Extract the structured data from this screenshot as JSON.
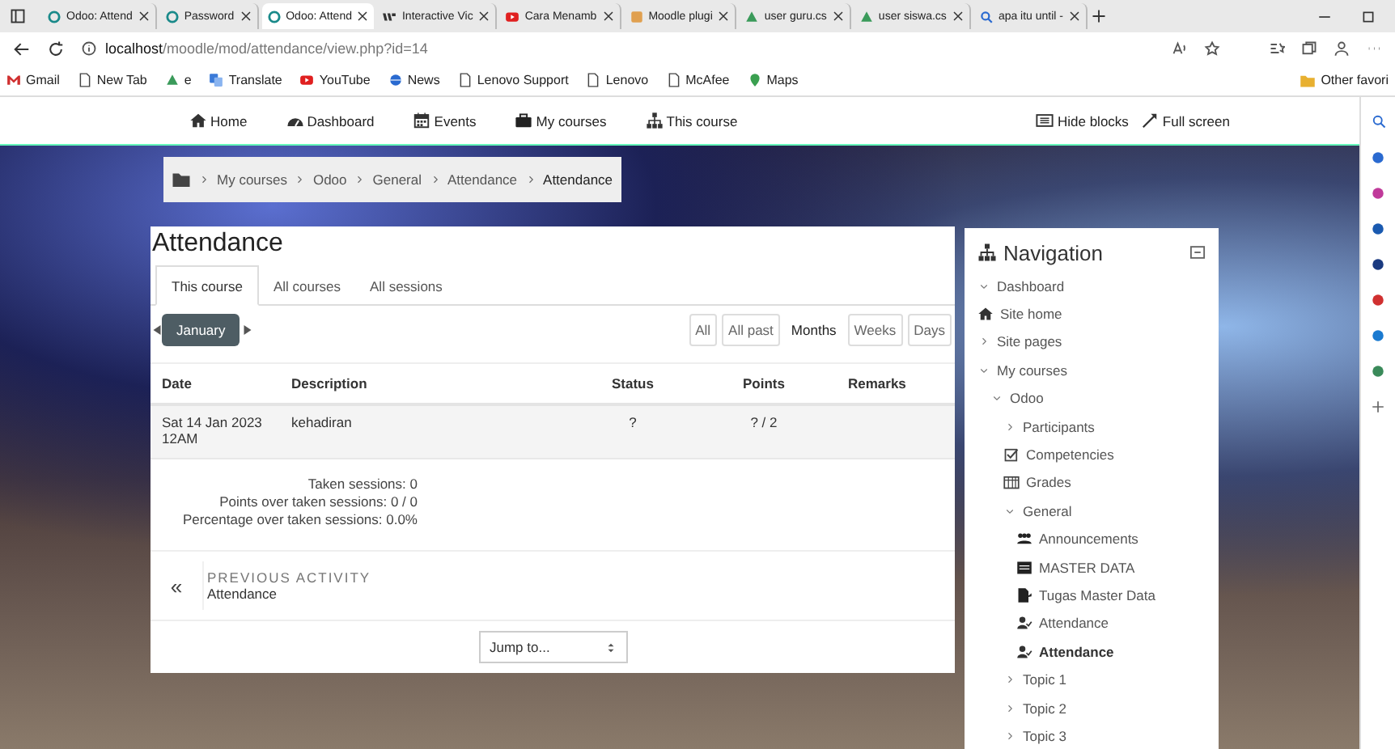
{
  "browser": {
    "tabs": [
      {
        "title": "Odoo: Attend",
        "kind": "moodle",
        "selected": false
      },
      {
        "title": "Password",
        "kind": "moodle",
        "selected": false
      },
      {
        "title": "Odoo: Attend",
        "kind": "moodle",
        "selected": true
      },
      {
        "title": "Interactive Vic",
        "kind": "ai",
        "selected": false
      },
      {
        "title": "Cara Menamb",
        "kind": "youtube",
        "selected": false
      },
      {
        "title": "Moodle plugi",
        "kind": "plugin",
        "selected": false
      },
      {
        "title": "user guru.cs",
        "kind": "drive",
        "selected": false
      },
      {
        "title": "user siswa.cs",
        "kind": "drive",
        "selected": false
      },
      {
        "title": "apa itu until -",
        "kind": "search",
        "selected": false
      }
    ],
    "address": {
      "host": "localhost",
      "path": "/moodle/mod/attendance/view.php?id=14"
    },
    "bookmarks": [
      {
        "label": "Gmail",
        "kind": "gmail"
      },
      {
        "label": "New Tab",
        "kind": "page"
      },
      {
        "label": "e",
        "kind": "drive"
      },
      {
        "label": "Translate",
        "kind": "translate"
      },
      {
        "label": "YouTube",
        "kind": "youtube"
      },
      {
        "label": "News",
        "kind": "news"
      },
      {
        "label": "Lenovo Support",
        "kind": "page"
      },
      {
        "label": "Lenovo",
        "kind": "page"
      },
      {
        "label": "McAfee",
        "kind": "page"
      },
      {
        "label": "Maps",
        "kind": "maps"
      }
    ],
    "other_favorites": "Other favori"
  },
  "site_nav": {
    "items": [
      {
        "label": "Home",
        "kind": "home"
      },
      {
        "label": "Dashboard",
        "kind": "dashboard"
      },
      {
        "label": "Events",
        "kind": "events"
      },
      {
        "label": "My courses",
        "kind": "courses"
      },
      {
        "label": "This course",
        "kind": "sitemap"
      }
    ],
    "actions": [
      {
        "label": "Hide blocks",
        "kind": "blocks"
      },
      {
        "label": "Full screen",
        "kind": "fullscreen"
      }
    ]
  },
  "breadcrumb": [
    "My courses",
    "Odoo",
    "General",
    "Attendance",
    "Attendance"
  ],
  "attendance": {
    "title": "Attendance",
    "tabs": [
      {
        "label": "This course",
        "selected": true
      },
      {
        "label": "All courses",
        "selected": false
      },
      {
        "label": "All sessions",
        "selected": false
      }
    ],
    "month": "January",
    "views": [
      {
        "label": "All",
        "selected": false
      },
      {
        "label": "All past",
        "selected": false
      },
      {
        "label": "Months",
        "selected": true
      },
      {
        "label": "Weeks",
        "selected": false
      },
      {
        "label": "Days",
        "selected": false
      }
    ],
    "table": {
      "columns": [
        "Date",
        "Description",
        "Status",
        "Points",
        "Remarks"
      ],
      "rows": [
        {
          "date": "Sat 14 Jan 2023 12AM",
          "description": "kehadiran",
          "status": "?",
          "points": "? / 2"
        }
      ]
    },
    "summary": [
      "Taken sessions: 0",
      "Points over taken sessions: 0 / 0",
      "Percentage over taken sessions: 0.0%"
    ],
    "previous_activity": {
      "marker": "«",
      "heading": "PREVIOUS ACTIVITY",
      "title": "Attendance"
    },
    "jump": {
      "placeholder": "Jump to..."
    }
  },
  "navigation": {
    "title": "Navigation",
    "items": [
      {
        "label": "Dashboard",
        "kind": "branch",
        "expanded": true,
        "selected": false
      },
      {
        "label": "Site home",
        "kind": "home",
        "selected": false
      },
      {
        "label": "Site pages",
        "kind": "branch",
        "expanded": false,
        "selected": false
      },
      {
        "label": "My courses",
        "kind": "branch",
        "expanded": true,
        "selected": false,
        "children": [
          {
            "label": "Odoo",
            "kind": "branch",
            "expanded": true,
            "selected": false,
            "children": [
              {
                "label": "Participants",
                "kind": "branch",
                "expanded": false,
                "selected": false
              },
              {
                "label": "Competencies",
                "kind": "competencies",
                "selected": false
              },
              {
                "label": "Grades",
                "kind": "grades",
                "selected": false
              },
              {
                "label": "General",
                "kind": "branch",
                "expanded": true,
                "selected": false,
                "children": [
                  {
                    "label": "Announcements",
                    "kind": "forum",
                    "selected": false
                  },
                  {
                    "label": "MASTER DATA",
                    "kind": "page",
                    "selected": false
                  },
                  {
                    "label": "Tugas Master Data",
                    "kind": "assignment",
                    "selected": false
                  },
                  {
                    "label": "Attendance",
                    "kind": "attendance",
                    "selected": false
                  },
                  {
                    "label": "Attendance",
                    "kind": "attendance",
                    "selected": true
                  }
                ]
              },
              {
                "label": "Topic 1",
                "kind": "branch",
                "expanded": false,
                "selected": false
              },
              {
                "label": "Topic 2",
                "kind": "branch",
                "expanded": false,
                "selected": false
              },
              {
                "label": "Topic 3",
                "kind": "branch",
                "expanded": false,
                "selected": false
              }
            ]
          }
        ]
      }
    ]
  }
}
